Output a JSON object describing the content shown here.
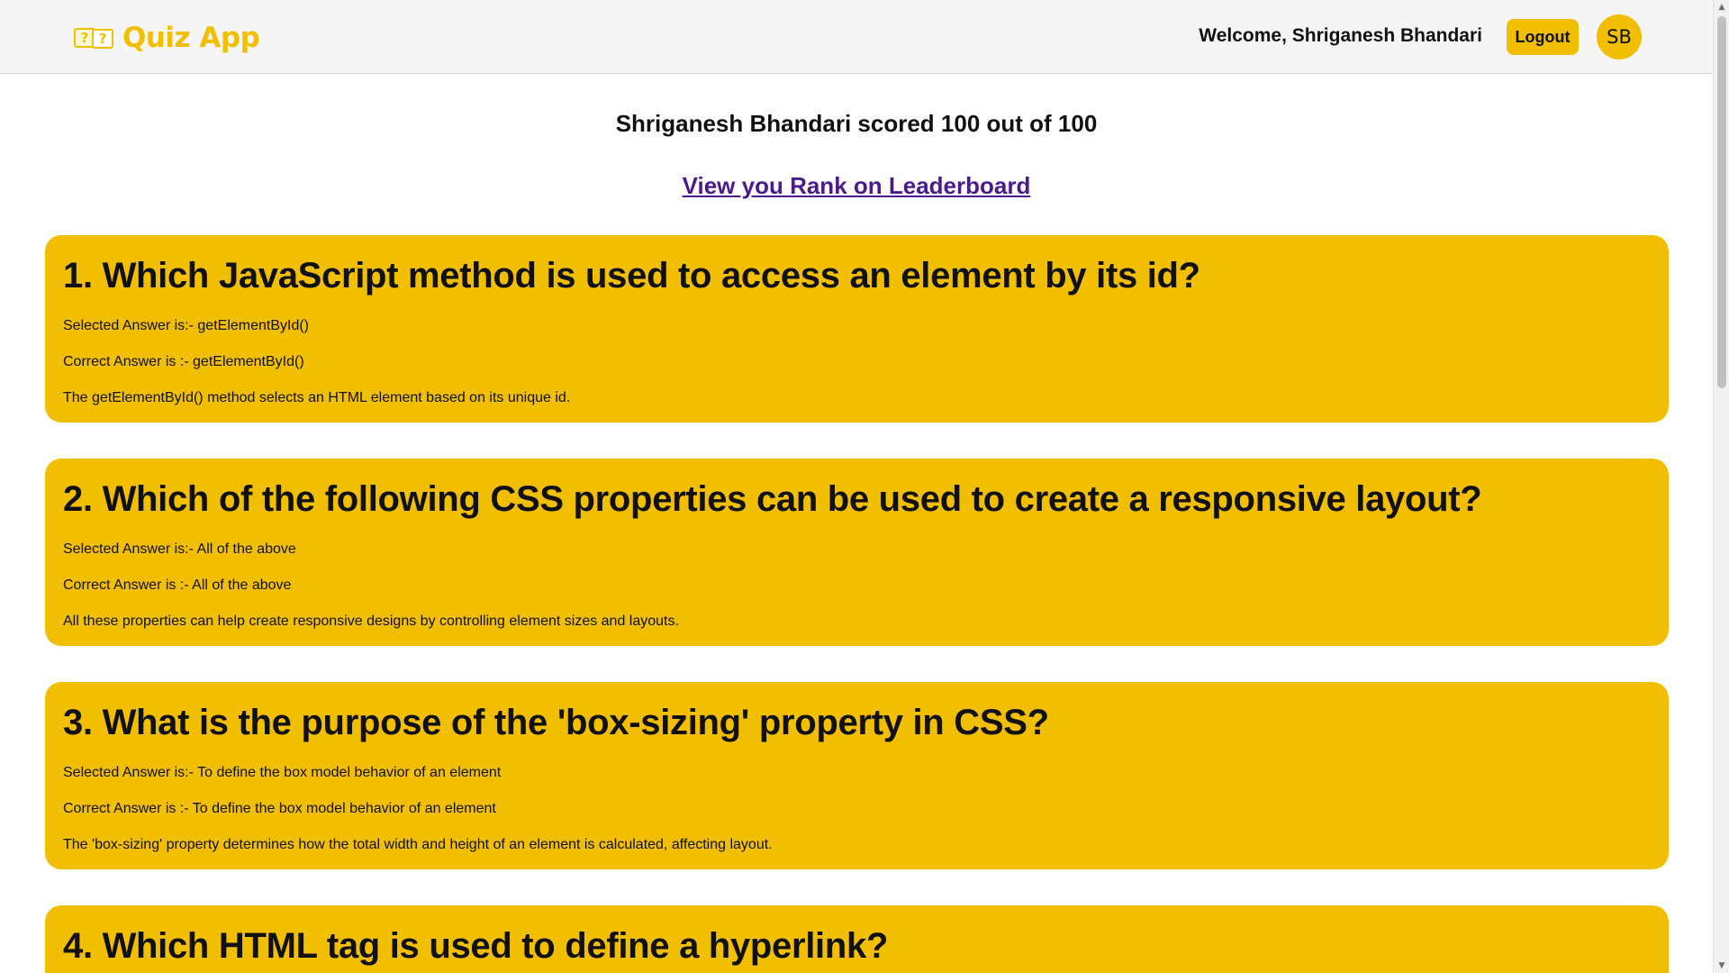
{
  "header": {
    "logo_text": "Quiz App",
    "logo_glyph": "?",
    "welcome_text": "Welcome, Shriganesh Bhandari",
    "logout_label": "Logout",
    "avatar_initials": "SB"
  },
  "result": {
    "score_text": "Shriganesh Bhandari scored 100 out of 100",
    "leaderboard_link": "View you Rank on Leaderboard"
  },
  "questions": [
    {
      "title": "1. Which JavaScript method is used to access an element by its id?",
      "selected": "Selected Answer is:- getElementById()",
      "correct": "Correct Answer is :- getElementById()",
      "explanation": "The getElementById() method selects an HTML element based on its unique id."
    },
    {
      "title": "2. Which of the following CSS properties can be used to create a responsive layout?",
      "selected": "Selected Answer is:- All of the above",
      "correct": "Correct Answer is :- All of the above",
      "explanation": "All these properties can help create responsive designs by controlling element sizes and layouts."
    },
    {
      "title": "3. What is the purpose of the 'box-sizing' property in CSS?",
      "selected": "Selected Answer is:- To define the box model behavior of an element",
      "correct": "Correct Answer is :- To define the box model behavior of an element",
      "explanation": "The 'box-sizing' property determines how the total width and height of an element is calculated, affecting layout."
    },
    {
      "title": "4. Which HTML tag is used to define a hyperlink?"
    }
  ],
  "colors": {
    "accent": "#f2be00",
    "link": "#4b1b8c",
    "header_bg": "#f5f5f5"
  },
  "scrollbar": {
    "up_arrow": "▲",
    "down_arrow": "▼"
  }
}
